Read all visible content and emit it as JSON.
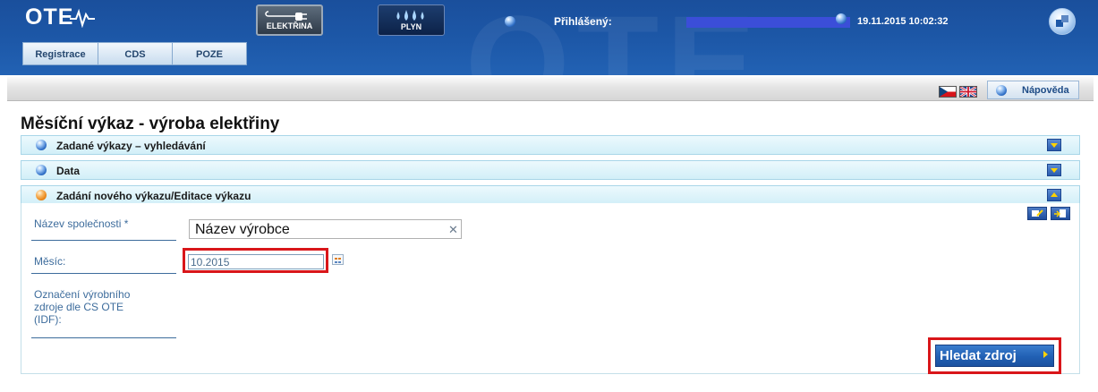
{
  "app": {
    "logo": "OTE",
    "top_nav": [
      {
        "label": "ELEKTŘINA",
        "icon": "plug-icon"
      },
      {
        "label": "PLYN",
        "icon": "flame-icon"
      }
    ],
    "login_label": "Přihlášený:",
    "datetime": "19.11.2015 10:02:32",
    "tabs": [
      "Registrace",
      "CDS",
      "POZE"
    ]
  },
  "toolbar": {
    "help_label": "Nápověda",
    "languages": [
      "cs",
      "en"
    ]
  },
  "page": {
    "title": "Měsíční výkaz - výroba elektřiny",
    "sections": [
      {
        "title": "Zadané výkazy – vyhledávání",
        "state": "collapsed"
      },
      {
        "title": "Data",
        "state": "collapsed"
      },
      {
        "title": "Zadání nového výkazu/Editace výkazu",
        "state": "expanded"
      }
    ]
  },
  "form": {
    "company_label": "Název společnosti *",
    "company_value": "Název výrobce",
    "month_label": "Měsíc:",
    "month_value": "10.2015",
    "idf_label": "Označení výrobního zdroje dle CS OTE (IDF):",
    "search_button": "Hledat zdroj"
  },
  "colors": {
    "header_blue": "#1d58a8",
    "accordion_bg": "#d2eff8",
    "label_blue": "#3d6c9c",
    "highlight_red": "#d9161a",
    "button_blue": "#2160b4"
  }
}
